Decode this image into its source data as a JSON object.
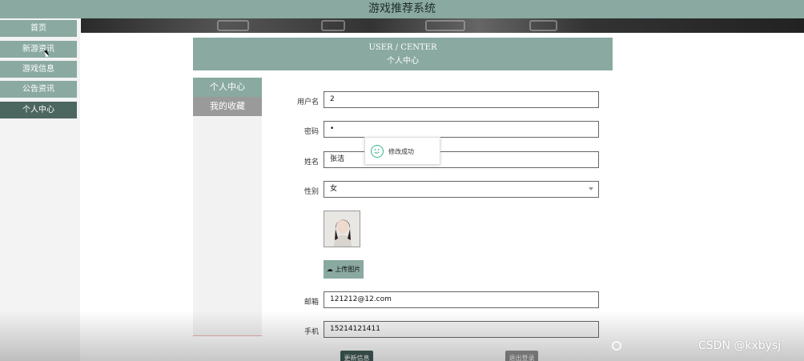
{
  "app": {
    "title": "游戏推荐系统"
  },
  "nav": {
    "items": [
      {
        "label": "首页"
      },
      {
        "label": "新游资讯"
      },
      {
        "label": "游戏信息"
      },
      {
        "label": "公告资讯"
      },
      {
        "label": "个人中心"
      }
    ]
  },
  "center": {
    "title_en": "USER / CENTER",
    "title_cn": "个人中心"
  },
  "side_menu": {
    "tabs": [
      {
        "label": "个人中心"
      },
      {
        "label": "我的收藏"
      }
    ]
  },
  "form": {
    "username": {
      "label": "用户名",
      "value": "2"
    },
    "password": {
      "label": "密码",
      "value": "•"
    },
    "name": {
      "label": "姓名",
      "value": "张洁"
    },
    "gender": {
      "label": "性别",
      "value": "女"
    },
    "upload_label": "上传图片",
    "email": {
      "label": "邮箱",
      "value": "121212@12.com"
    },
    "phone": {
      "label": "手机",
      "value": "15214121411"
    }
  },
  "toast": {
    "text": "修改成功"
  },
  "buttons": {
    "save": "更新信息",
    "logout": "退出登录"
  },
  "watermark": "CSDN @kxbysj",
  "colors": {
    "accent": "#8aa9a1",
    "nav_active": "#4c6660",
    "success": "#3bb58c"
  }
}
